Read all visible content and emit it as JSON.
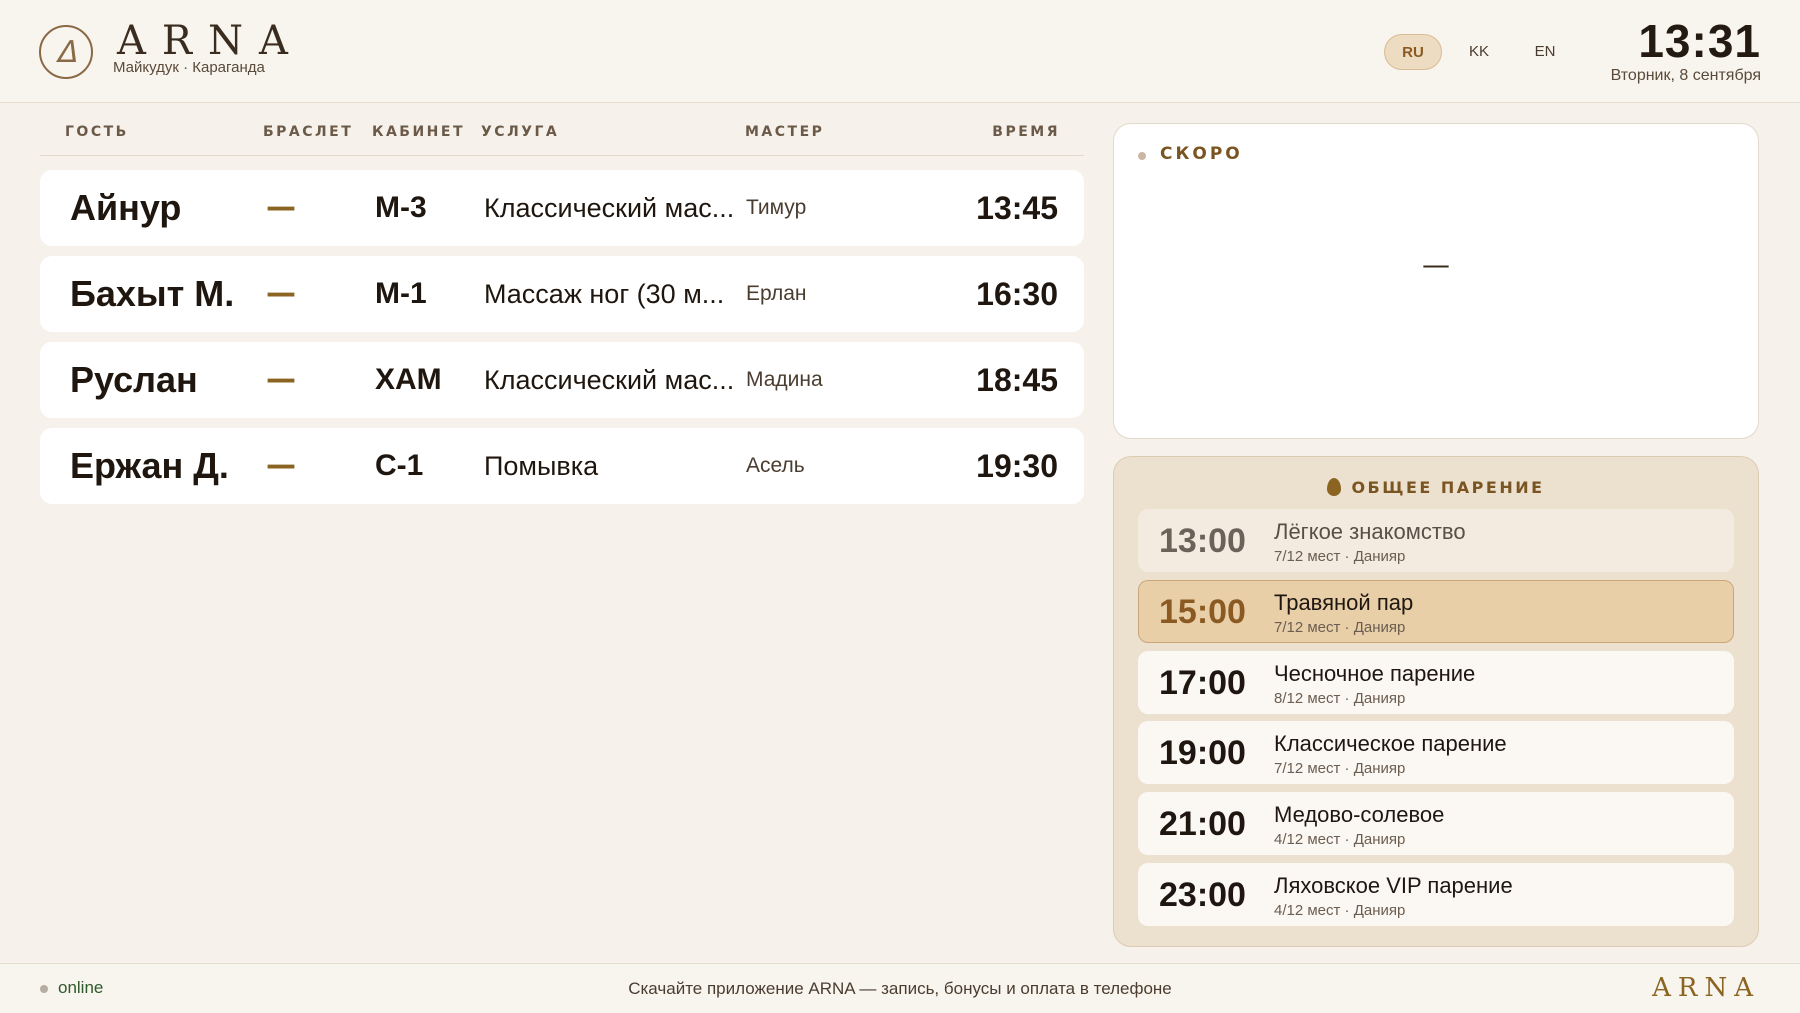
{
  "header": {
    "logo_icon": "logo-emblem-icon",
    "brand": "ARNA",
    "location": "Майкудук · Караганда",
    "languages": [
      "RU",
      "KK",
      "EN"
    ],
    "active_language": "RU",
    "time": "13:31",
    "date": "Вторник, 8 сентября"
  },
  "guests": {
    "columns": [
      "ГОСТЬ",
      "БРАСЛЕТ",
      "КАБИНЕТ",
      "УСЛУГА",
      "МАСТЕР",
      "ВРЕМЯ"
    ],
    "rows": [
      {
        "guest": "Айнур",
        "bracelet": "—",
        "room": "М-3",
        "service": "Классический мас...",
        "master": "Тимур",
        "time": "13:45"
      },
      {
        "guest": "Бахыт М.",
        "bracelet": "—",
        "room": "М-1",
        "service": "Массаж ног (30 м...",
        "master": "Ерлан",
        "time": "16:30"
      },
      {
        "guest": "Руслан",
        "bracelet": "—",
        "room": "ХАМ",
        "service": "Классический мас...",
        "master": "Мадина",
        "time": "18:45"
      },
      {
        "guest": "Ержан Д.",
        "bracelet": "—",
        "room": "С-1",
        "service": "Помывка",
        "master": "Асель",
        "time": "19:30"
      }
    ]
  },
  "soon": {
    "title": "СКОРО",
    "empty": "—"
  },
  "steam": {
    "icon": "flame-drop-icon",
    "title": "ОБЩЕЕ ПАРЕНИЕ",
    "sessions": [
      {
        "time": "13:00",
        "name": "Лёгкое знакомство",
        "meta": "7/12 мест · Данияр",
        "state": "past"
      },
      {
        "time": "15:00",
        "name": "Травяной пар",
        "meta": "7/12 мест · Данияр",
        "state": "current"
      },
      {
        "time": "17:00",
        "name": "Чесночное парение",
        "meta": "8/12 мест · Данияр",
        "state": "upcoming"
      },
      {
        "time": "19:00",
        "name": "Классическое парение",
        "meta": "7/12 мест · Данияр",
        "state": "upcoming"
      },
      {
        "time": "21:00",
        "name": "Медово-солевое",
        "meta": "4/12 мест · Данияр",
        "state": "upcoming"
      },
      {
        "time": "23:00",
        "name": "Ляховское VIP парение",
        "meta": "4/12 мест · Данияр",
        "state": "upcoming"
      }
    ]
  },
  "footer": {
    "status": "online",
    "message": "Скачайте приложение ARNA — запись, бонусы и оплата в телефоне",
    "brand": "ARNA"
  },
  "colors": {
    "background": "#f6f1eb",
    "accent": "#8a6420",
    "current_session": "#e8cfa8",
    "online": "#2f5a2b"
  }
}
